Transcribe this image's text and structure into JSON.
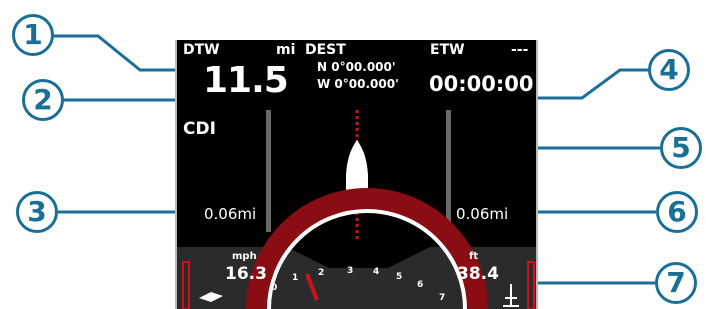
{
  "screen": {
    "dtw": {
      "label": "DTW",
      "unit": "mi",
      "value": "11.5"
    },
    "dest": {
      "label": "DEST",
      "lat": "N 0°00.000'",
      "lon": "W 0°00.000'"
    },
    "etw": {
      "label": "ETW",
      "extra": "---",
      "value": "00:00:00"
    },
    "cdi": {
      "label": "CDI",
      "left_value": "0.06mi",
      "right_value": "0.06mi"
    },
    "speed": {
      "unit": "mph",
      "value": "16.3"
    },
    "depth": {
      "unit": "ft",
      "value": "38.4"
    },
    "gauge_ticks": [
      "0",
      "1",
      "2",
      "3",
      "4",
      "5",
      "6",
      "7"
    ]
  },
  "callouts": [
    "1",
    "2",
    "3",
    "4",
    "5",
    "6",
    "7"
  ],
  "colors": {
    "callout": "#1a6f97",
    "needle": "#d0101a",
    "screen_bg": "#000000"
  }
}
